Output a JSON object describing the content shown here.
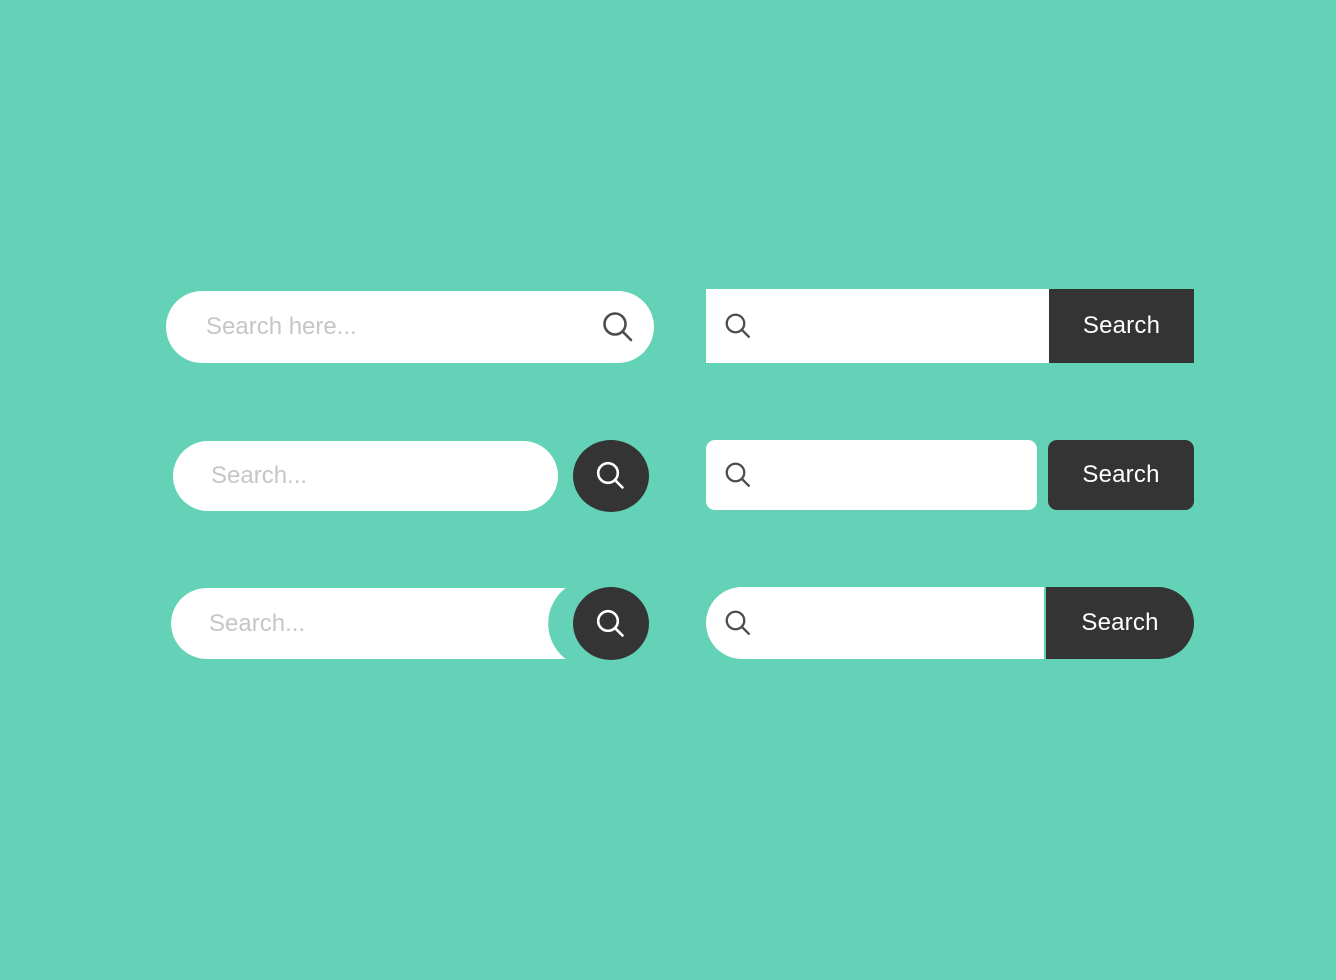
{
  "page": {
    "title": "Search Bar UI Kit",
    "background_color": "#63D2B6",
    "accent_dark": "#343434",
    "field_background": "#FFFFFF",
    "placeholder_color": "#C6C6C6",
    "icon_color_dark": "#4D4D4D",
    "icon_color_light": "#FFFFFF"
  },
  "rows": [
    {
      "left": {
        "style": "pill-with-inline-icon",
        "placeholder": "Search here...",
        "value": "",
        "icon": "search-icon"
      },
      "right": {
        "style": "square-field-with-square-button",
        "placeholder": "",
        "value": "",
        "icon": "search-icon",
        "button_label": "Search"
      }
    },
    {
      "left": {
        "style": "pill-with-circle-button",
        "placeholder": "Search...",
        "value": "",
        "icon": "search-icon"
      },
      "right": {
        "style": "rounded-field-with-rounded-button",
        "placeholder": "",
        "value": "",
        "icon": "search-icon",
        "button_label": "Search"
      }
    },
    {
      "left": {
        "style": "notched-pill-with-circle-button",
        "placeholder": "Search...",
        "value": "",
        "icon": "search-icon"
      },
      "right": {
        "style": "capsule-split-field-and-button",
        "placeholder": "",
        "value": "",
        "icon": "search-icon",
        "button_label": "Search"
      }
    }
  ]
}
